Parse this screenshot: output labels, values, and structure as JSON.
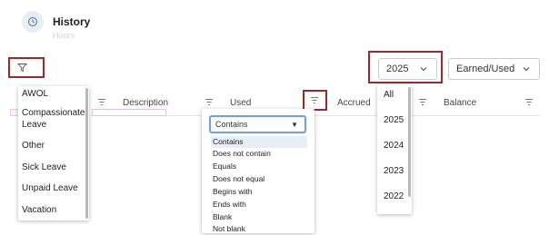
{
  "header": {
    "title": "History",
    "subtitle": "Hours"
  },
  "controls": {
    "year_value": "2025",
    "type_value": "Earned/Used"
  },
  "columns": [
    {
      "label": ""
    },
    {
      "label": "Description"
    },
    {
      "label": "Used"
    },
    {
      "label": "Accrued"
    },
    {
      "label": "Balance"
    }
  ],
  "leave_types": [
    "AWOL",
    "Compassionate Leave",
    "Other",
    "Sick Leave",
    "Unpaid Leave",
    "Vacation"
  ],
  "year_options": [
    "All",
    "2025",
    "2024",
    "2023",
    "2022"
  ],
  "condition": {
    "selected": "Contains",
    "options": [
      "Contains",
      "Does not contain",
      "Equals",
      "Does not equal",
      "Begins with",
      "Ends with",
      "Blank",
      "Not blank"
    ]
  },
  "icons": {
    "header": "clock-icon",
    "filter": "funnel-icon",
    "column_filter": "filter-lines-icon",
    "chevron": "chevron-down-icon"
  },
  "colors": {
    "highlight": "#9b2a2a",
    "focus": "#6ea2dd",
    "selected_option": "#e8eef5"
  }
}
